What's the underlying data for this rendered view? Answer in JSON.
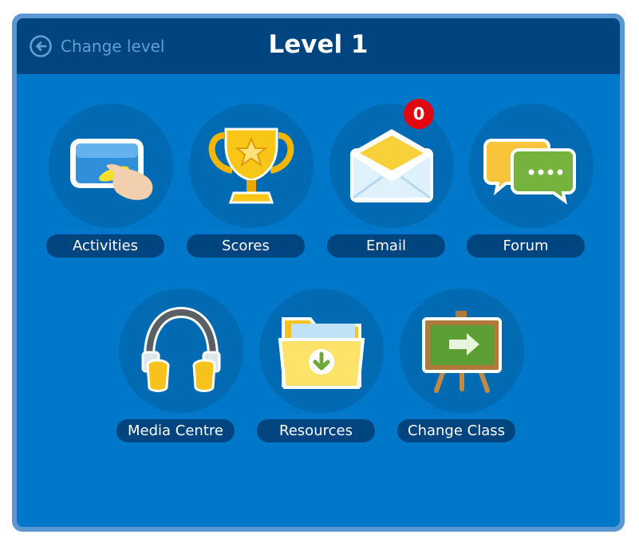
{
  "header": {
    "back_label": "Change level",
    "back_icon": "arrow-left-circle-icon",
    "title": "Level 1"
  },
  "tiles": [
    {
      "label": "Activities",
      "icon": "tablet-touch-icon"
    },
    {
      "label": "Scores",
      "icon": "trophy-icon"
    },
    {
      "label": "Email",
      "icon": "envelope-icon",
      "badge": "0"
    },
    {
      "label": "Forum",
      "icon": "chat-bubbles-icon"
    },
    {
      "label": "Media Centre",
      "icon": "headphones-icon"
    },
    {
      "label": "Resources",
      "icon": "folder-download-icon"
    },
    {
      "label": "Change Class",
      "icon": "easel-arrow-icon"
    }
  ],
  "colors": {
    "frame": "#5b97d2",
    "panel": "#0077c8",
    "header": "#00457f",
    "disc": "#006bb3",
    "label_pill": "#00457f",
    "badge": "#e3060e",
    "back_text": "#5f9fd3"
  }
}
